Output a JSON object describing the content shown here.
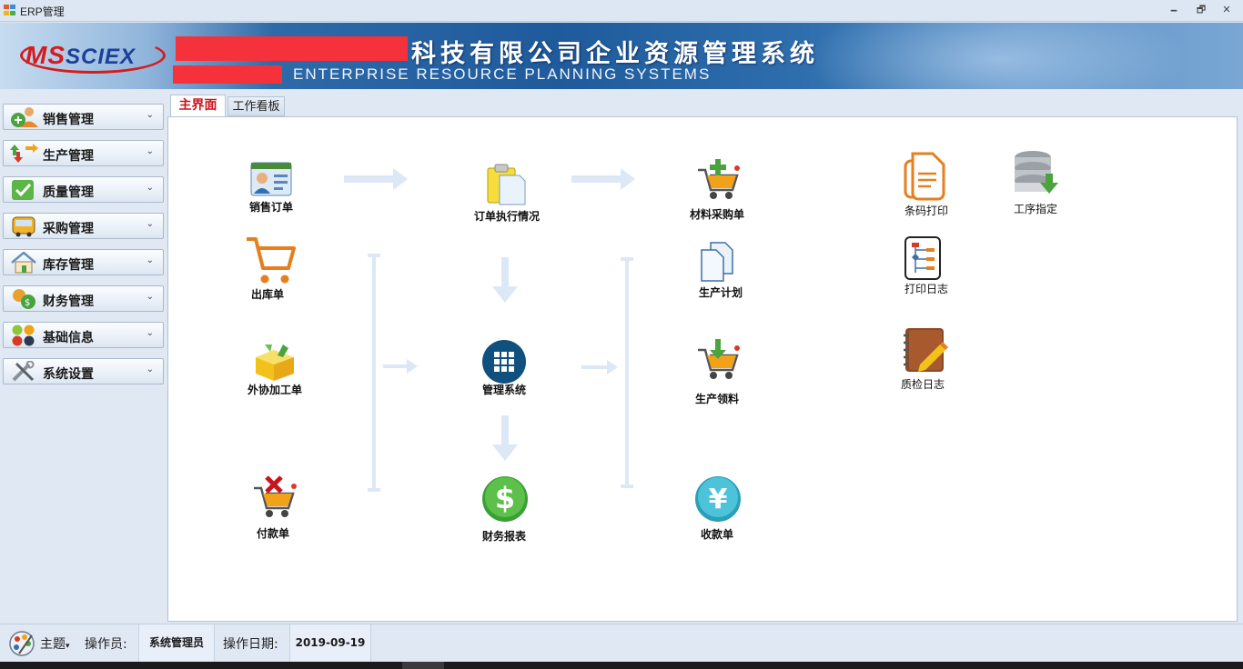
{
  "window": {
    "title": "ERP管理",
    "minimize_glyph": "🗕",
    "restore_glyph": "🗗",
    "close_glyph": "✕"
  },
  "banner": {
    "logo_ms": "MS",
    "logo_sciex": "SCIEX",
    "company_name": "科技有限公司企业资源管理系统",
    "subtitle": "ENTERPRISE RESOURCE PLANNING SYSTEMS"
  },
  "sidebar": {
    "items": [
      {
        "label": "销售管理",
        "icon": "sales-person-icon"
      },
      {
        "label": "生产管理",
        "icon": "production-arrows-icon"
      },
      {
        "label": "质量管理",
        "icon": "quality-check-icon"
      },
      {
        "label": "采购管理",
        "icon": "purchase-bus-icon"
      },
      {
        "label": "库存管理",
        "icon": "inventory-house-icon"
      },
      {
        "label": "财务管理",
        "icon": "finance-coins-icon"
      },
      {
        "label": "基础信息",
        "icon": "basic-info-dots-icon"
      },
      {
        "label": "系统设置",
        "icon": "settings-tools-icon"
      }
    ],
    "chevron": "⌄"
  },
  "tabs": [
    {
      "label": "主界面",
      "active": true
    },
    {
      "label": "工作看板",
      "active": false
    }
  ],
  "functions": {
    "sales_order": "销售订单",
    "order_exec": "订单执行情况",
    "material_purchase": "材料采购单",
    "barcode_print": "条码打印",
    "process_assign": "工序指定",
    "outbound": "出库单",
    "production_plan": "生产计划",
    "print_log": "打印日志",
    "outsource": "外协加工单",
    "mgmt_system": "管理系统",
    "production_material": "生产领料",
    "qc_log": "质检日志",
    "payment": "付款单",
    "finance_report": "财务报表",
    "receipt": "收款单"
  },
  "statusbar": {
    "theme_label": "主题",
    "theme_caret": "▾",
    "operator_label": "操作员:",
    "operator_value": "系统管理员",
    "date_label": "操作日期:",
    "date_value": "2019-09-19"
  },
  "colors": {
    "accent_red": "#c8141e",
    "banner_blue": "#1f5b9c",
    "panel_bg": "#dfe8f3",
    "arrow": "#dce8f6"
  }
}
